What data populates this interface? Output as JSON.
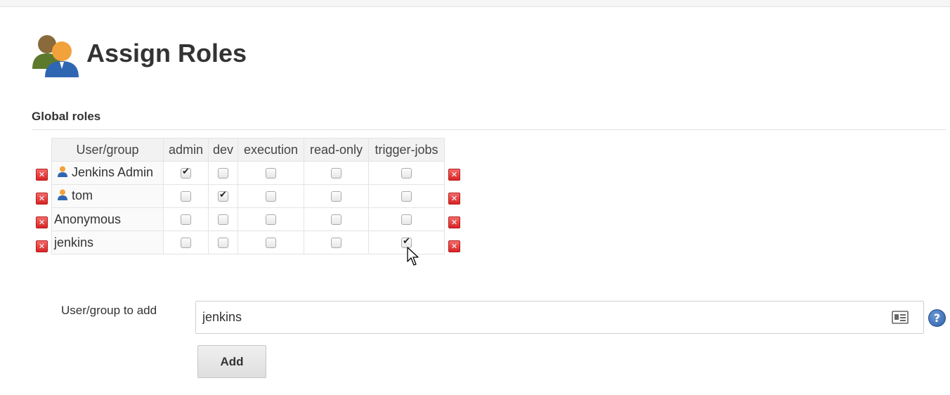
{
  "page": {
    "title": "Assign Roles"
  },
  "section": {
    "title": "Global roles"
  },
  "table": {
    "columns": [
      "User/group",
      "admin",
      "dev",
      "execution",
      "read-only",
      "trigger-jobs"
    ],
    "rows": [
      {
        "name": "Jenkins Admin",
        "icon": "user-icon",
        "checks": [
          true,
          false,
          false,
          false,
          false
        ]
      },
      {
        "name": "tom",
        "icon": "user-icon",
        "checks": [
          false,
          true,
          false,
          false,
          false
        ]
      },
      {
        "name": "Anonymous",
        "icon": null,
        "checks": [
          false,
          false,
          false,
          false,
          false
        ]
      },
      {
        "name": "jenkins",
        "icon": null,
        "checks": [
          false,
          false,
          false,
          false,
          true
        ]
      }
    ]
  },
  "add_form": {
    "label": "User/group to add",
    "input_value": "jenkins",
    "button_label": "Add"
  },
  "colors": {
    "delete": "#d82424",
    "help": "#2d5ea8",
    "header_bg": "#f2f2f2"
  }
}
